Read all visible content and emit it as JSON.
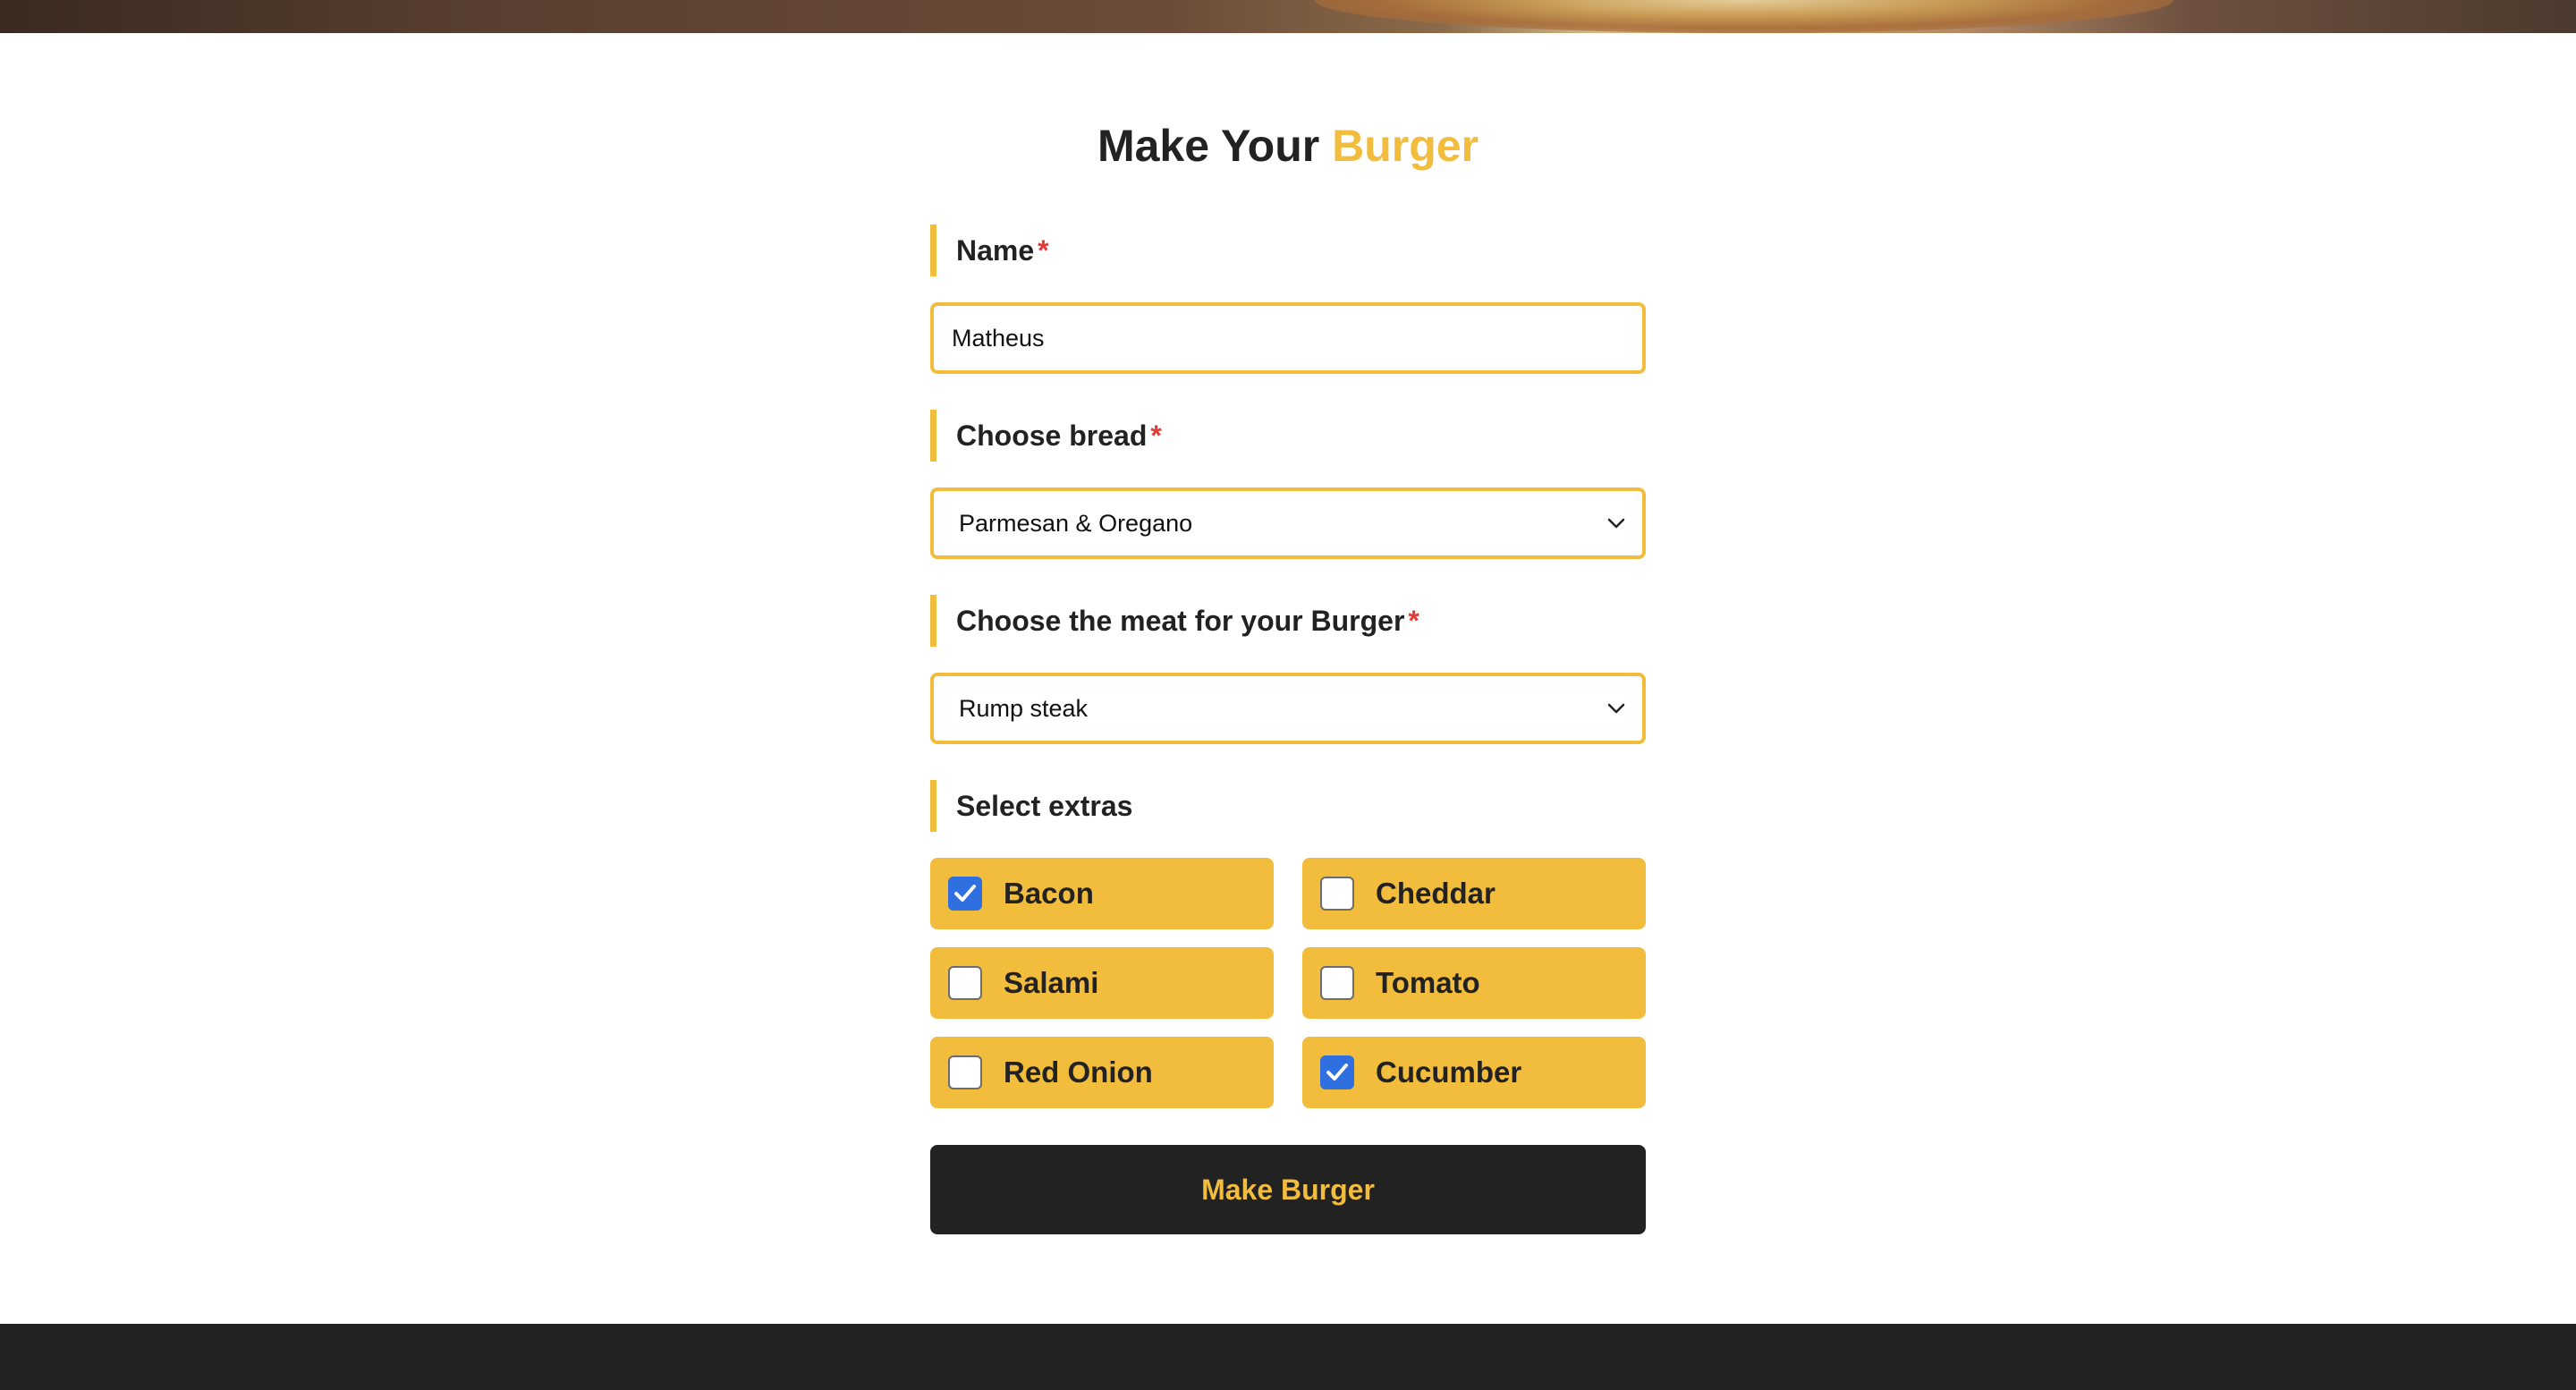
{
  "page": {
    "title_main": "Make Your ",
    "title_accent": "Burger"
  },
  "form": {
    "name": {
      "label": "Name",
      "required_mark": "*",
      "value": "Matheus"
    },
    "bread": {
      "label": "Choose bread",
      "required_mark": "*",
      "selected": "Parmesan & Oregano",
      "icon": "chevron-down-icon"
    },
    "meat": {
      "label": "Choose the meat for your Burger",
      "required_mark": "*",
      "selected": "Rump steak",
      "icon": "chevron-down-icon"
    },
    "extras": {
      "label": "Select extras",
      "options": [
        {
          "label": "Bacon",
          "checked": true
        },
        {
          "label": "Cheddar",
          "checked": false
        },
        {
          "label": "Salami",
          "checked": false
        },
        {
          "label": "Tomato",
          "checked": false
        },
        {
          "label": "Red Onion",
          "checked": false
        },
        {
          "label": "Cucumber",
          "checked": true
        }
      ]
    },
    "submit_label": "Make Burger"
  },
  "colors": {
    "accent": "#f2bc3d",
    "dark": "#222222",
    "required": "#e53935",
    "checkbox_checked": "#2f6fe0"
  }
}
